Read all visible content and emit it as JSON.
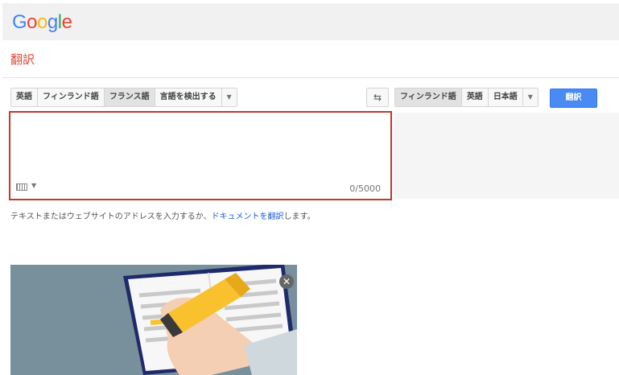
{
  "logo": {
    "letters": [
      {
        "ch": "G",
        "color": "#4285f4"
      },
      {
        "ch": "o",
        "color": "#ea4335"
      },
      {
        "ch": "o",
        "color": "#fbbc05"
      },
      {
        "ch": "g",
        "color": "#4285f4"
      },
      {
        "ch": "l",
        "color": "#34a853"
      },
      {
        "ch": "e",
        "color": "#ea4335"
      }
    ]
  },
  "page_title": "翻訳",
  "source_langs": [
    "英語",
    "フィンランド語",
    "フランス語",
    "言語を検出する"
  ],
  "source_selected": "フランス語",
  "target_langs": [
    "フィンランド語",
    "英語",
    "日本語"
  ],
  "target_selected": "フィンランド語",
  "translate_button": "翻訳",
  "input": {
    "value": "",
    "counter": "0/5000"
  },
  "hint": {
    "prefix": "テキストまたはウェブサイトのアドレスを入力するか、",
    "link": "ドキュメントを翻訳",
    "suffix": "します。"
  },
  "colors": {
    "accent": "#4a8af4",
    "title": "#dd4b39",
    "active_border": "#c0392b"
  }
}
